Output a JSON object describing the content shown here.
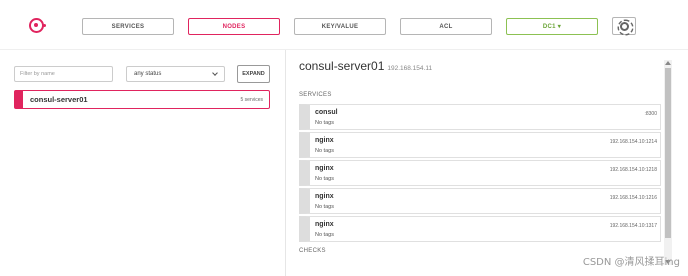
{
  "nav": {
    "services": "SERVICES",
    "nodes": "NODES",
    "kv": "KEY/VALUE",
    "acl": "ACL",
    "datacenter": "DC1 ▾"
  },
  "filters": {
    "name_placeholder": "Filter by name",
    "status_selected": "any status",
    "expand_label": "EXPAND"
  },
  "nodes": [
    {
      "name": "consul-server01",
      "count": "5 services"
    }
  ],
  "detail": {
    "title": "consul-server01",
    "ip": "192.168.154.11",
    "services_label": "SERVICES",
    "checks_label": "CHECKS",
    "services": [
      {
        "name": "consul",
        "tags": "No tags",
        "address": ":8300"
      },
      {
        "name": "nginx",
        "tags": "No tags",
        "address": "192.168.154.10:1214"
      },
      {
        "name": "nginx",
        "tags": "No tags",
        "address": "192.168.154.10:1218"
      },
      {
        "name": "nginx",
        "tags": "No tags",
        "address": "192.168.154.10:1216"
      },
      {
        "name": "nginx",
        "tags": "No tags",
        "address": "192.168.154.10:1317"
      }
    ]
  },
  "watermark": "CSDN @清风揉耳ing",
  "colors": {
    "accent": "#e0245e",
    "dc": "#8cc152"
  }
}
